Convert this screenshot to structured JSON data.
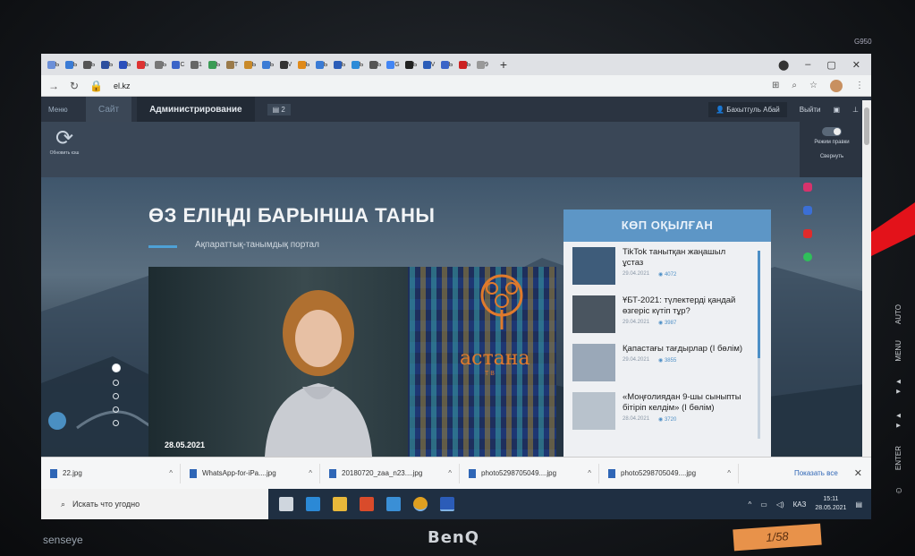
{
  "monitor": {
    "brand": "BenQ",
    "sub_brand": "senseye",
    "model": "G950",
    "sticker": "1/58",
    "side_buttons": [
      "AUTO",
      "MENU",
      "◄ ►",
      "◄ ►",
      "ENTER",
      "⏻"
    ]
  },
  "browser": {
    "tabs": [
      "Ь",
      "Ь",
      "Ь",
      "Ь",
      "Ь",
      "Ь",
      "Ь",
      "C",
      "1",
      "Ь",
      "T",
      "Ь",
      "Ь",
      "V",
      "Ь",
      "Ь",
      "Ь",
      "Ь",
      "Ь",
      "G",
      "Ь",
      "V",
      "Ь",
      "Ь",
      "9"
    ],
    "tab_colors": [
      "#6b8fd8",
      "#3a7bd5",
      "#555",
      "#2c4f9e",
      "#2b4fbc",
      "#d33",
      "#777",
      "#3a64c8",
      "#666",
      "#3a9b55",
      "#9a7a4a",
      "#c98a2a",
      "#3a7bd5",
      "#333",
      "#e08a1a",
      "#3a7bd5",
      "#2b5db8",
      "#2b8bd8",
      "#555",
      "#4285f4",
      "#222",
      "#2b5db8",
      "#3a64c8",
      "#c22",
      "#999"
    ],
    "url": "el.kz",
    "window_controls": [
      "⬤",
      "–",
      "▢",
      "✕"
    ]
  },
  "admin_bar": {
    "menu": "Меню",
    "tab_site": "Сайт",
    "tab_admin": "Администрирование",
    "badge": "2",
    "user": "Бахытгуль Абай",
    "logout": "Выйти"
  },
  "toolbar": {
    "refresh_label": "Обновить кэш",
    "edit_mode": "Режим правки",
    "collapse": "Свернуть"
  },
  "hero": {
    "title": "ӨЗ ЕЛІҢДІ БАРЫНША ТАНЫ",
    "subtitle": "Ақпараттық-танымдық портал",
    "video_date": "28.05.2021",
    "logo_name": "астана",
    "logo_sub": "ТВ"
  },
  "popular": {
    "heading": "КӨП ОҚЫЛҒАН",
    "items": [
      {
        "title": "TikTok танытқан жаңашыл ұстаз",
        "date": "29.04.2021",
        "views": "4072",
        "thumb": "#3e5c7a"
      },
      {
        "title": "ҰБТ-2021: түлектерді қандай өзгеріс күтіп тұр?",
        "date": "29.04.2021",
        "views": "3987",
        "thumb": "#4a5560"
      },
      {
        "title": "Қапастағы тағдырлар (І бөлім)",
        "date": "29.04.2021",
        "views": "3855",
        "thumb": "#9aa8b8"
      },
      {
        "title": "«Моңғолиядан 9-шы сыныпты бітіріп келдім» (І бөлім)",
        "date": "28.04.2021",
        "views": "3720",
        "thumb": "#b8c2cc"
      }
    ]
  },
  "social_colors": [
    "#d6336c",
    "#3b6fd6",
    "#e02b2b",
    "#2fbf5a"
  ],
  "downloads": [
    {
      "name": "22.jpg"
    },
    {
      "name": "WhatsApp-for-iPa....jpg"
    },
    {
      "name": "20180720_zaa_n23....jpg"
    },
    {
      "name": "photo5298705049....jpg"
    },
    {
      "name": "photo5298705049....jpg"
    }
  ],
  "download_show_all": "Показать все",
  "taskbar": {
    "search_placeholder": "Искать что угодно",
    "lang": "КАЗ",
    "time": "15:11",
    "date": "28.05.2021",
    "app_colors": [
      "#cfd6de",
      "#2b89d6",
      "#e8b83a",
      "#d94b2b",
      "#3a8fd6",
      "#e0a020",
      "#2b5cb8"
    ]
  }
}
